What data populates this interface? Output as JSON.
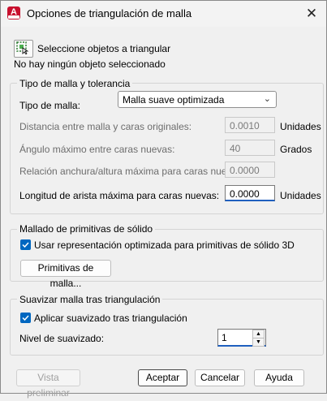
{
  "window": {
    "title": "Opciones de triangulación de malla",
    "app_icon_letter": "A"
  },
  "select_objects": {
    "label": "Seleccione objetos a triangular",
    "status": "No hay ningún objeto seleccionado"
  },
  "mesh_type_group": {
    "legend": "Tipo de malla y tolerancia",
    "mesh_type_label": "Tipo de malla:",
    "mesh_type_value": "Malla suave optimizada",
    "distance_label": "Distancia entre malla y caras originales:",
    "distance_value": "0.0010",
    "distance_unit": "Unidades",
    "angle_label": "Ángulo máximo entre caras nuevas:",
    "angle_value": "40",
    "angle_unit": "Grados",
    "ratio_label": "Relación anchura/altura máxima para caras nuevas:",
    "ratio_value": "0.0000",
    "edge_label": "Longitud de arista máxima para caras nuevas:",
    "edge_value": "0.0000",
    "edge_unit": "Unidades"
  },
  "primitives_group": {
    "legend": "Mallado de primitivas de sólido",
    "optimized_label": "Usar representación optimizada para primitivas de sólido 3D",
    "optimized_checked": true,
    "primitives_button": "Primitivas de malla..."
  },
  "smooth_group": {
    "legend": "Suavizar malla tras triangulación",
    "apply_label": "Aplicar suavizado tras triangulación",
    "apply_checked": true,
    "level_label": "Nivel de suavizado:",
    "level_value": "1"
  },
  "footer": {
    "preview": "Vista preliminar",
    "accept": "Aceptar",
    "cancel": "Cancelar",
    "help": "Ayuda"
  }
}
